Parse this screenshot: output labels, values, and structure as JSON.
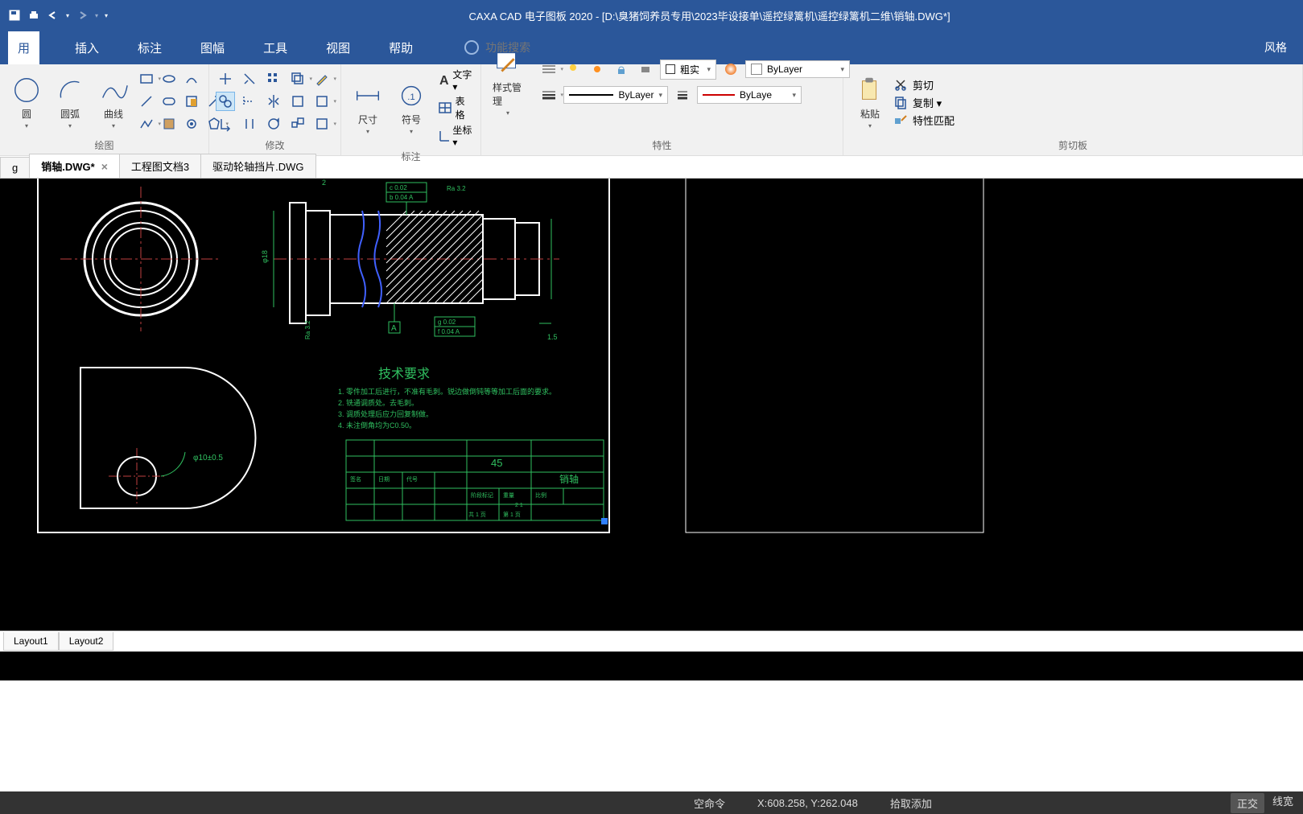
{
  "title": "CAXA CAD 电子图板 2020 - [D:\\臭猪饲养员专用\\2023毕设接单\\遥控绿篱机\\遥控绿篱机二维\\销轴.DWG*]",
  "menu": {
    "items": [
      "用",
      "插入",
      "标注",
      "图幅",
      "工具",
      "视图",
      "帮助"
    ],
    "search_placeholder": "功能搜索",
    "right": "风格"
  },
  "ribbon": {
    "draw": {
      "label": "绘图",
      "big": [
        {
          "label": "圆",
          "dd": "▾"
        },
        {
          "label": "圆弧",
          "dd": "▾"
        },
        {
          "label": "曲线",
          "dd": "▾"
        }
      ]
    },
    "modify": {
      "label": "修改"
    },
    "annotate": {
      "label": "标注",
      "big": [
        {
          "label": "尺寸",
          "dd": "▾"
        },
        {
          "label": "符号",
          "dd": "▾"
        }
      ],
      "side": [
        "文字 ▾",
        "表格",
        "坐标 ▾"
      ]
    },
    "style": {
      "label": "特性",
      "big": "样式管理"
    },
    "props": {
      "linetype": "粗实",
      "layer": "ByLayer",
      "color": "ByLayer",
      "lineweight": "ByLaye"
    },
    "clipboard": {
      "label": "剪切板",
      "paste": "粘贴",
      "items": [
        "剪切",
        "复制 ▾",
        "特性匹配"
      ]
    }
  },
  "doc_tabs": [
    {
      "label": "g",
      "active": false
    },
    {
      "label": "销轴.DWG*",
      "active": true,
      "closable": true
    },
    {
      "label": "工程图文档3",
      "active": false
    },
    {
      "label": "驱动轮轴挡片.DWG",
      "active": false
    }
  ],
  "drawing": {
    "tech_req_title": "技术要求",
    "tech_req_lines": [
      "1. 零件加工后进行，不准有毛刺。锐边做倒钝等等加工后面的要求。",
      "2. 铣通调质处。去毛刺。",
      "3. 调质处理后应力回复制做。",
      "4. 未注倒角均为C0.50。"
    ],
    "tol_top": [
      "c 0.02",
      "b 0.04 A"
    ],
    "tol_bottom": [
      "g 0.02",
      "f 0.04 A"
    ],
    "datum": "A",
    "dim_left": "φ18",
    "dim_r1": "Ra 3.2",
    "dim_r2": "Ra 3.2",
    "dim_bottom": "1.5",
    "dim_radius": "φ10±0.5",
    "title_block_main": "45",
    "title_block_name": "销轴",
    "title_block_rows": [
      "签名",
      "日期",
      "代号",
      "阶段标记",
      "重量",
      "比例",
      "2 1",
      "共 1 页",
      "第 1 页"
    ]
  },
  "layout_tabs": [
    "Layout1",
    "Layout2"
  ],
  "status": {
    "cmd": "空命令",
    "coords": "X:608.258, Y:262.048",
    "snap": "拾取添加",
    "ortho": "正交",
    "lw": "线宽"
  }
}
